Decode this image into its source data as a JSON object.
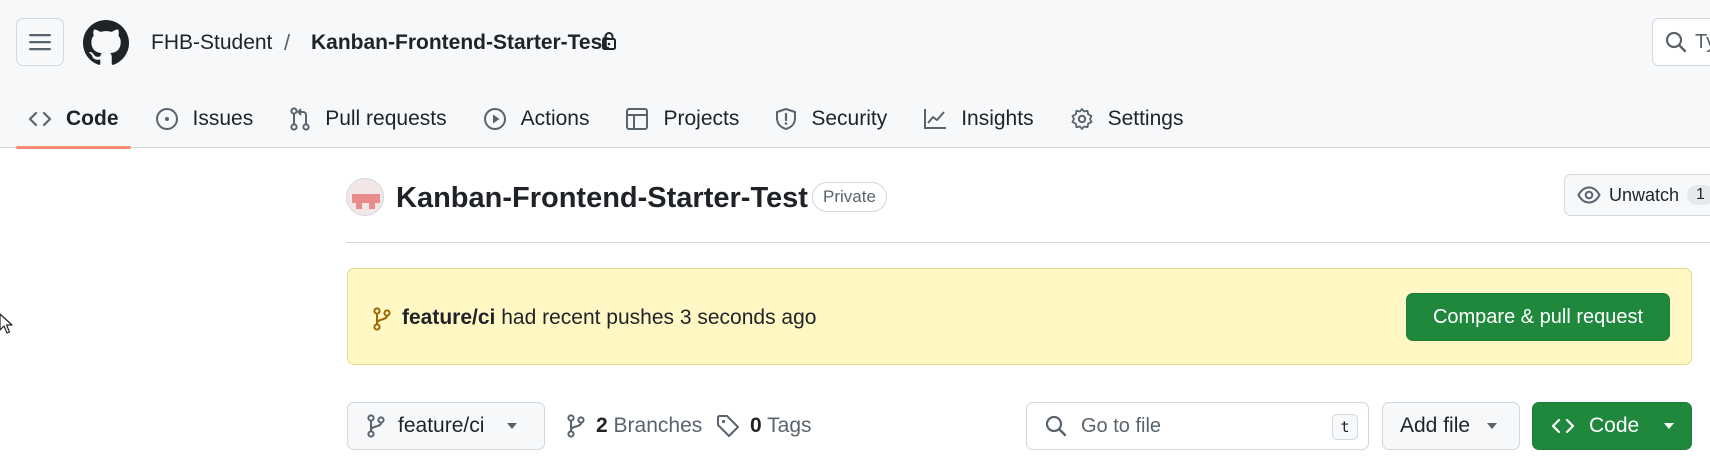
{
  "header": {
    "owner": "FHB-Student",
    "separator": "/",
    "repo": "Kanban-Frontend-Starter-Test",
    "search_placeholder": "Ty"
  },
  "tabs": [
    {
      "label": "Code",
      "icon": "code-icon",
      "active": true
    },
    {
      "label": "Issues",
      "icon": "issue-icon"
    },
    {
      "label": "Pull requests",
      "icon": "pull-request-icon"
    },
    {
      "label": "Actions",
      "icon": "play-icon"
    },
    {
      "label": "Projects",
      "icon": "table-icon"
    },
    {
      "label": "Security",
      "icon": "shield-icon"
    },
    {
      "label": "Insights",
      "icon": "graph-icon"
    },
    {
      "label": "Settings",
      "icon": "gear-icon"
    }
  ],
  "repo_header": {
    "title": "Kanban-Frontend-Starter-Test",
    "visibility": "Private",
    "watch_label": "Unwatch",
    "watch_count": "1"
  },
  "banner": {
    "branch": "feature/ci",
    "message": "had recent pushes 3 seconds ago",
    "button": "Compare & pull request"
  },
  "toolbar": {
    "current_branch": "feature/ci",
    "branch_count": "2",
    "branches_label": "Branches",
    "tag_count": "0",
    "tags_label": "Tags",
    "goto_placeholder": "Go to file",
    "goto_shortcut": "t",
    "add_file": "Add file",
    "code_button": "Code"
  },
  "colors": {
    "primary_green": "#1f883d",
    "banner_bg": "#fff8c5",
    "active_tab_underline": "#fd8c73",
    "header_bg": "#f6f8fa"
  }
}
